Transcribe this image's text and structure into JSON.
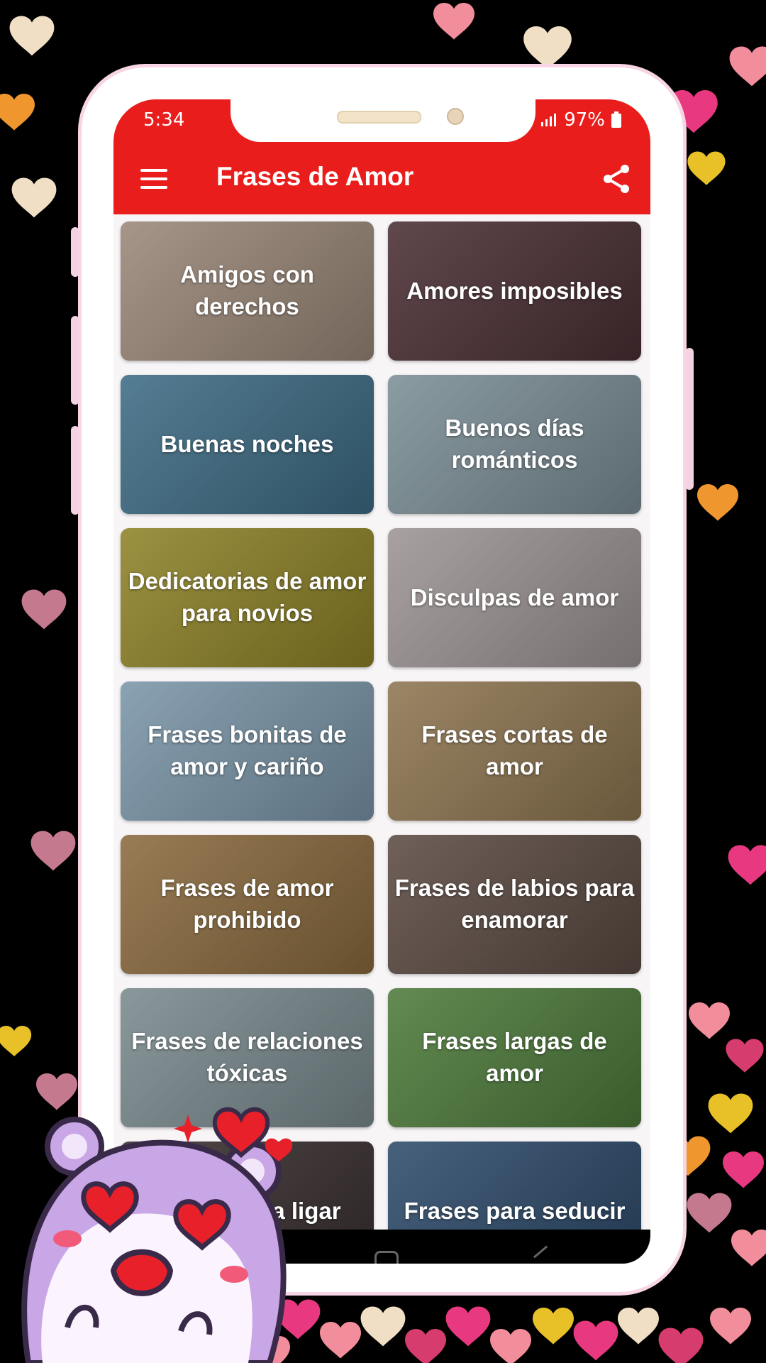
{
  "status_bar": {
    "time": "5:34",
    "battery": "97%"
  },
  "app_bar": {
    "title": "Frases de Amor",
    "menu_icon": "hamburger-menu-icon",
    "share_icon": "share-icon"
  },
  "categories": [
    {
      "label": "Amigos con derechos",
      "bg": "#9a8778"
    },
    {
      "label": "Amores imposibles",
      "bg": "#4a2f34"
    },
    {
      "label": "Buenas noches",
      "bg": "#3d6b84"
    },
    {
      "label": "Buenos días románticos",
      "bg": "#7b8e96"
    },
    {
      "label": "Dedicatorias de amor para novios",
      "bg": "#8d8227"
    },
    {
      "label": "Disculpas de amor",
      "bg": "#9d9494"
    },
    {
      "label": "Frases bonitas de amor y cariño",
      "bg": "#7a95a8"
    },
    {
      "label": "Frases cortas de amor",
      "bg": "#8d7550"
    },
    {
      "label": "Frases de amor prohibido",
      "bg": "#8a6a3e"
    },
    {
      "label": "Frases de labios para enamorar",
      "bg": "#5b4a42"
    },
    {
      "label": "Frases de relaciones tóxicas",
      "bg": "#7a8a8e"
    },
    {
      "label": "Frases largas de amor",
      "bg": "#4d7a3a"
    },
    {
      "label": "Frases para ligar",
      "bg": "#3a3030"
    },
    {
      "label": "Frases para seducir",
      "bg": "#2d4a6a"
    }
  ],
  "colors": {
    "accent": "#ea1d1d",
    "frame": "#f7d5e4"
  }
}
